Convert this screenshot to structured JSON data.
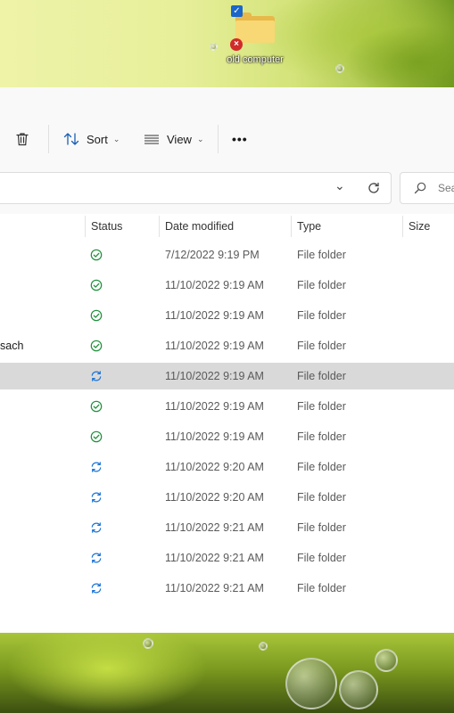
{
  "desktop": {
    "icon_label": "old computer"
  },
  "toolbar": {
    "sort_label": "Sort",
    "view_label": "View",
    "more_label": "•••"
  },
  "search": {
    "placeholder": "Sea"
  },
  "columns": {
    "status": "Status",
    "date_modified": "Date modified",
    "type": "Type",
    "size": "Size"
  },
  "files": [
    {
      "name_fragment": "",
      "status": "synced",
      "date": "7/12/2022 9:19 PM",
      "type": "File folder",
      "selected": false
    },
    {
      "name_fragment": "",
      "status": "synced",
      "date": "11/10/2022 9:19 AM",
      "type": "File folder",
      "selected": false
    },
    {
      "name_fragment": "",
      "status": "synced",
      "date": "11/10/2022 9:19 AM",
      "type": "File folder",
      "selected": false
    },
    {
      "name_fragment": "sach",
      "status": "synced",
      "date": "11/10/2022 9:19 AM",
      "type": "File folder",
      "selected": false
    },
    {
      "name_fragment": "",
      "status": "syncing",
      "date": "11/10/2022 9:19 AM",
      "type": "File folder",
      "selected": true
    },
    {
      "name_fragment": "",
      "status": "synced",
      "date": "11/10/2022 9:19 AM",
      "type": "File folder",
      "selected": false
    },
    {
      "name_fragment": "",
      "status": "synced",
      "date": "11/10/2022 9:19 AM",
      "type": "File folder",
      "selected": false
    },
    {
      "name_fragment": "",
      "status": "syncing",
      "date": "11/10/2022 9:20 AM",
      "type": "File folder",
      "selected": false
    },
    {
      "name_fragment": "",
      "status": "syncing",
      "date": "11/10/2022 9:20 AM",
      "type": "File folder",
      "selected": false
    },
    {
      "name_fragment": "",
      "status": "syncing",
      "date": "11/10/2022 9:21 AM",
      "type": "File folder",
      "selected": false
    },
    {
      "name_fragment": "",
      "status": "syncing",
      "date": "11/10/2022 9:21 AM",
      "type": "File folder",
      "selected": false
    },
    {
      "name_fragment": "",
      "status": "syncing",
      "date": "11/10/2022 9:21 AM",
      "type": "File folder",
      "selected": false
    }
  ],
  "colors": {
    "synced": "#1e8f3a",
    "syncing": "#1a73d8",
    "selected_row": "#d9d9d9"
  },
  "icons": {
    "delete": "trash-icon",
    "sort": "sort-arrows-icon",
    "view": "view-lines-icon",
    "dropdown": "chevron-down-icon",
    "refresh": "refresh-icon",
    "search": "search-icon",
    "synced": "check-circle-icon",
    "syncing": "sync-arrows-icon"
  }
}
